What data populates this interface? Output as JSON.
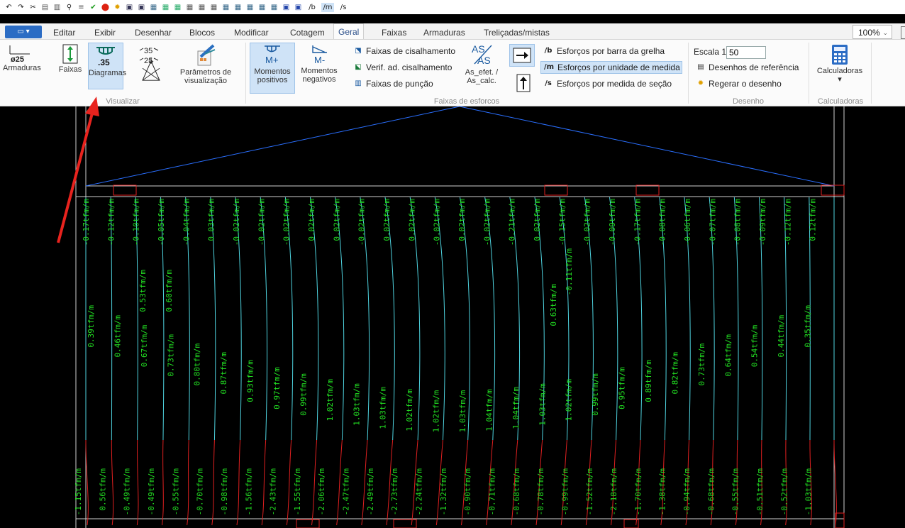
{
  "tabs": [
    "Editar",
    "Exibir",
    "Desenhar",
    "Blocos",
    "Modificar",
    "Cotagem",
    "Geral",
    "Faixas",
    "Armaduras",
    "Treliçadas/mistas"
  ],
  "active_tab": "Geral",
  "zoom": "100%",
  "groups": {
    "visualizar": "Visualizar",
    "faixas_esforcos": "Faixas de esforcos",
    "desenho": "Desenho",
    "calculadoras": "Calculadoras"
  },
  "visualizar": {
    "armaduras_glyph": "ø25",
    "armaduras": "Armaduras",
    "faixas": "Faixas",
    "diagramas_glyph": ".35",
    "diagramas": "Diagramas",
    "param_line1": "Parâmetros de",
    "param_line2": "visualização"
  },
  "faixas": {
    "mpos_glyph": "M+",
    "mpos_line1": "Momentos",
    "mpos_line2": "positivos",
    "mneg_glyph": "M-",
    "mneg_line1": "Momentos",
    "mneg_line2": "negativos",
    "cisalhamento": "Faixas de cisalhamento",
    "verif": "Verif. ad. cisalhamento",
    "puncao": "Faixas de punção",
    "as_top": "AS",
    "as_bottom": "AS",
    "as_line1": "As_efet. /",
    "as_line2": "As_calc.",
    "esf_barra_glyph": "/b",
    "esf_barra": "Esforços por barra da grelha",
    "esf_unid_glyph": "/m",
    "esf_unid": "Esforços por unidade de medida",
    "esf_secao_glyph": "/s",
    "esf_secao": "Esforços por medida de seção"
  },
  "desenho": {
    "escala_label": "Escala 1:",
    "escala_value": "50",
    "desenhos_ref": "Desenhos de referência",
    "regerar": "Regerar o desenho"
  },
  "calculadoras": {
    "label": "Calculadoras",
    "chevron": "▾"
  },
  "colors": {
    "cyan": "#4fd4e0",
    "green": "#22e022",
    "red": "#e02020",
    "blue_line": "#2a6fff",
    "arrow": "#e8231e"
  },
  "drawing": {
    "top_labels": [
      "-0.17tfm/m",
      "-0.12tfm/m",
      "-0.10tfm/m",
      "-0.05tfm/m",
      "-0.04tfm/m",
      "0.03tfm/m",
      "-0.02tfm/m",
      "-0.02tfm/m",
      "-0.02tfm/m",
      "0.02tfm/m",
      "0.02tfm/m",
      "-0.02tfm/m",
      "0.02tfm/m",
      "0.02tfm/m",
      "-0.02tfm/m",
      "0.02tfm/m",
      "-0.02tfm/m",
      "-0.21tfm/m",
      "0.02tfm/m",
      "-0.15tfm/m",
      "-0.02tfm/m",
      "-0.09tfm/m",
      "-0.17tfm/m",
      "-0.08tfm/m",
      "-0.06tfm/m",
      "-0.07tfm/m",
      "-0.08tfm/m",
      "-0.09tfm/m",
      "-0.12tfm/m",
      "0.12tfm/m"
    ],
    "upper_mid_labels": [
      "0.53tfm/m",
      "0.60tfm/m",
      "0.63tfm/m",
      "-0.11tfm/m"
    ],
    "mid_labels": [
      "0.39tfm/m",
      "0.46tfm/m",
      "0.67tfm/m",
      "0.73tfm/m",
      "0.80tfm/m",
      "0.87tfm/m",
      "0.93tfm/m",
      "0.97tfm/m",
      "0.99tfm/m",
      "1.02tfm/m",
      "1.03tfm/m",
      "1.03tfm/m",
      "1.02tfm/m",
      "1.02tfm/m",
      "1.03tfm/m",
      "1.04tfm/m",
      "1.04tfm/m",
      "1.03tfm/m",
      "1.02tfm/m",
      "0.99tfm/m",
      "0.95tfm/m",
      "0.89tfm/m",
      "0.82tfm/m",
      "0.73tfm/m",
      "0.64tfm/m",
      "0.54tfm/m",
      "0.44tfm/m",
      "0.35tfm/m"
    ],
    "bottom_labels": [
      "-1.15tfm/m",
      "0.56tfm/m",
      "-0.49tfm/m",
      "-0.49tfm/m",
      "-0.55tfm/m",
      "-0.70tfm/m",
      "-0.98tfm/m",
      "-1.56tfm/m",
      "-2.43tfm/m",
      "-1.55tfm/m",
      "-2.06tfm/m",
      "-2.47tfm/m",
      "-2.49tfm/m",
      "-2.73tfm/m",
      "-2.24tfm/m",
      "-1.32tfm/m",
      "-0.90tfm/m",
      "-0.71tfm/m",
      "-0.68tfm/m",
      "-0.78tfm/m",
      "-0.99tfm/m",
      "-1.52tfm/m",
      "-2.18tfm/m",
      "-1.70tfm/m",
      "-1.38tfm/m",
      "-0.94tfm/m",
      "-0.68tfm/m",
      "-0.55tfm/m",
      "-0.51tfm/m",
      "-0.52tfm/m",
      "-1.03tfm/m"
    ]
  }
}
